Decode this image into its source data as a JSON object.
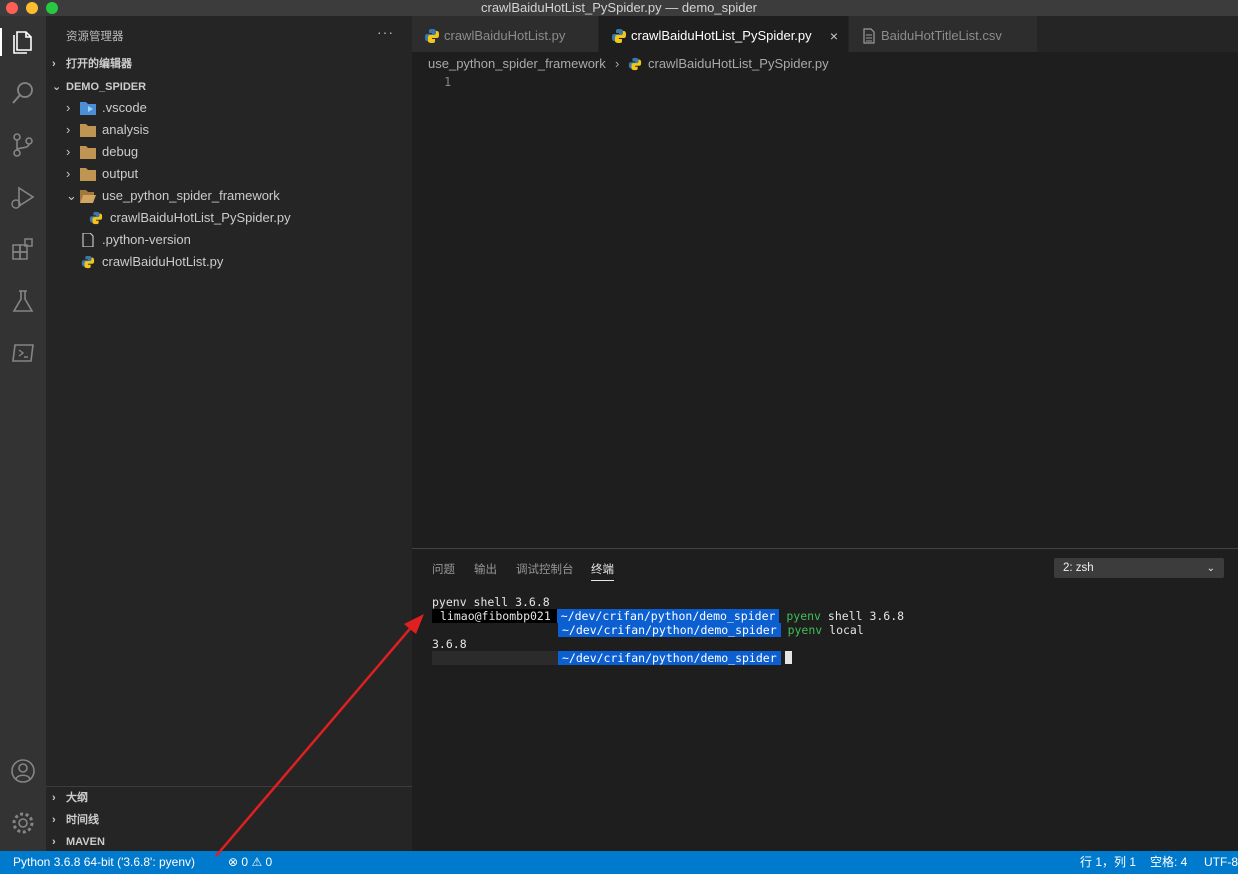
{
  "window": {
    "title": "crawlBaiduHotList_PySpider.py — demo_spider"
  },
  "sidebar": {
    "title": "资源管理器",
    "more": "···",
    "open_editors": "打开的编辑器",
    "project": "DEMO_SPIDER",
    "tree": [
      {
        "label": ".vscode",
        "type": "folder-vscode"
      },
      {
        "label": "analysis",
        "type": "folder"
      },
      {
        "label": "debug",
        "type": "folder"
      },
      {
        "label": "output",
        "type": "folder"
      },
      {
        "label": "use_python_spider_framework",
        "type": "folder-open"
      },
      {
        "label": "crawlBaiduHotList_PySpider.py",
        "type": "python"
      },
      {
        "label": ".python-version",
        "type": "file"
      },
      {
        "label": "crawlBaiduHotList.py",
        "type": "python"
      }
    ],
    "outline": "大纲",
    "timeline": "时间线",
    "maven": "MAVEN"
  },
  "tabs": [
    {
      "label": "crawlBaiduHotList.py"
    },
    {
      "label": "crawlBaiduHotList_PySpider.py",
      "close": "×"
    },
    {
      "label": "BaiduHotTitleList.csv"
    }
  ],
  "breadcrumb": {
    "folder": "use_python_spider_framework",
    "sep": "›",
    "file": "crawlBaiduHotList_PySpider.py"
  },
  "editor": {
    "line_number": "1"
  },
  "panel": {
    "tabs": [
      "问题",
      "输出",
      "调试控制台",
      "终端"
    ],
    "terminal_select": "2: zsh",
    "terminal": {
      "line1": "pyenv shell 3.6.8",
      "user": "limao@fibombp021",
      "path": "~/dev/crifan/python/demo_spider",
      "cmd1_name": "pyenv",
      "cmd1_args": "shell 3.6.8",
      "cmd2_name": "pyenv",
      "cmd2_args": "local",
      "output": "3.6.8"
    }
  },
  "statusbar": {
    "python": "Python 3.6.8 64-bit ('3.6.8': pyenv)",
    "errors": "0",
    "warnings": "0",
    "position": "行 1，列 1",
    "spaces": "空格: 4",
    "encoding": "UTF-8"
  },
  "colors": {
    "accent": "#007acc",
    "terminal_path_bg": "#0b5fd1",
    "annotation": "#e02020"
  }
}
